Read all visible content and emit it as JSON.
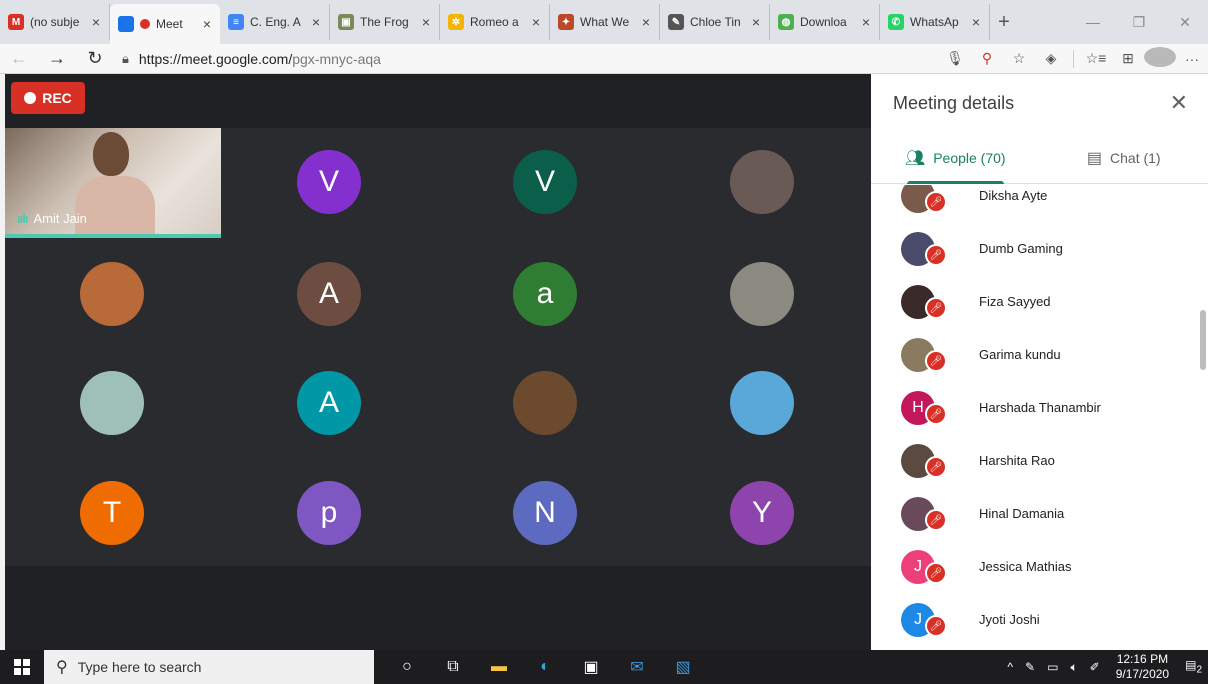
{
  "browser": {
    "tabs": [
      {
        "title": "(no subje",
        "icon": "gmail-icon",
        "color": "#d93025",
        "glyph": "M",
        "active": false
      },
      {
        "title": "Meet",
        "icon": "meet-icon",
        "color": "#1a73e8",
        "glyph": "",
        "active": true
      },
      {
        "title": "C. Eng. A",
        "icon": "docs-icon",
        "color": "#4285f4",
        "glyph": "≡",
        "active": false
      },
      {
        "title": "The Frog",
        "icon": "image-icon",
        "color": "#7a8a5a",
        "glyph": "▣",
        "active": false
      },
      {
        "title": "Romeo a",
        "icon": "dots-icon",
        "color": "#f4b400",
        "glyph": "✲",
        "active": false
      },
      {
        "title": "What We",
        "icon": "site-icon",
        "color": "#b84a2a",
        "glyph": "✦",
        "active": false
      },
      {
        "title": "Chloe Tin",
        "icon": "site-icon",
        "color": "#555555",
        "glyph": "✎",
        "active": false
      },
      {
        "title": "Downloa",
        "icon": "download-site-icon",
        "color": "#4caf50",
        "glyph": "◍",
        "active": false
      },
      {
        "title": "WhatsAp",
        "icon": "whatsapp-icon",
        "color": "#25d366",
        "glyph": "✆",
        "active": false
      }
    ],
    "tab_close": "×",
    "new_tab": "+",
    "window_controls": {
      "minimize": "—",
      "restore": "❐",
      "close": "✕"
    },
    "url_host": "https://meet.google.com/",
    "url_path": "pgx-mnyc-aqa"
  },
  "meet": {
    "rec_label": "REC",
    "main_participant": "Amit Jain",
    "tiles": [
      {
        "letter": "V",
        "color": "#8430ce"
      },
      {
        "letter": "V",
        "color": "#0b5e4a"
      },
      {
        "letter": "",
        "color": "#6a5a55"
      },
      {
        "letter": "",
        "color": "#b86a38"
      },
      {
        "letter": "A",
        "color": "#6d4c41"
      },
      {
        "letter": "a",
        "color": "#2e7d32"
      },
      {
        "letter": "",
        "color": "#8a8a80"
      },
      {
        "letter": "",
        "color": "#9fc0b8"
      },
      {
        "letter": "A",
        "color": "#0097a7"
      },
      {
        "letter": "",
        "color": "#6b4a2e"
      },
      {
        "letter": "",
        "color": "#5aa8d8"
      },
      {
        "letter": "T",
        "color": "#ef6c00"
      },
      {
        "letter": "p",
        "color": "#7e57c2"
      },
      {
        "letter": "N",
        "color": "#5c6bc0"
      },
      {
        "letter": "Y",
        "color": "#8e44ad"
      }
    ]
  },
  "panel": {
    "title": "Meeting details",
    "close": "✕",
    "people_tab": "People (70)",
    "chat_tab": "Chat (1)",
    "people": [
      {
        "name": "Diksha Ayte",
        "initial": "",
        "color": "#7a5a4a"
      },
      {
        "name": "Dumb Gaming",
        "initial": "",
        "color": "#4a4a6a"
      },
      {
        "name": "Fiza Sayyed",
        "initial": "",
        "color": "#3a2a2a"
      },
      {
        "name": "Garima kundu",
        "initial": "",
        "color": "#8a7a60"
      },
      {
        "name": "Harshada Thanambir",
        "initial": "H",
        "color": "#c2185b"
      },
      {
        "name": "Harshita Rao",
        "initial": "",
        "color": "#5a4a40"
      },
      {
        "name": "Hinal Damania",
        "initial": "",
        "color": "#6a4a5a"
      },
      {
        "name": "Jessica Mathias",
        "initial": "J",
        "color": "#ec407a"
      },
      {
        "name": "Jyoti Joshi",
        "initial": "J",
        "color": "#1e88e5"
      }
    ]
  },
  "taskbar": {
    "search_placeholder": "Type here to search",
    "time": "12:16 PM",
    "date": "9/17/2020",
    "notifications": "2"
  }
}
